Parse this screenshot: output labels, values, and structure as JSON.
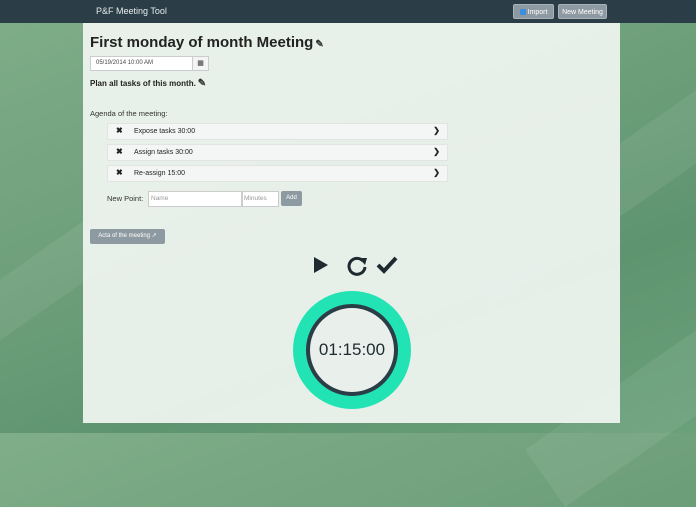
{
  "app": {
    "brand": "P&F Meeting Tool"
  },
  "header": {
    "import_label": "Import",
    "new_meeting_label": "New Meeting"
  },
  "meeting": {
    "title": "First monday of month Meeting",
    "datetime": "05/19/2014 10:00 AM",
    "plan": "Plan all tasks of this month."
  },
  "agenda": {
    "label": "Agenda of the meeting:",
    "items": [
      {
        "text": "Expose tasks 30:00"
      },
      {
        "text": "Assign tasks 30:00"
      },
      {
        "text": "Re-assign 15:00"
      }
    ]
  },
  "new_point": {
    "label": "New Point:",
    "name_placeholder": "Name",
    "minutes_placeholder": "Minutes",
    "add_label": "Add"
  },
  "acta": {
    "label": "Acta of the meeting"
  },
  "timer": {
    "value": "01:15:00"
  },
  "colors": {
    "accent": "#22e3b4",
    "topbar": "#2b3d46",
    "button": "#8e9aa1"
  }
}
